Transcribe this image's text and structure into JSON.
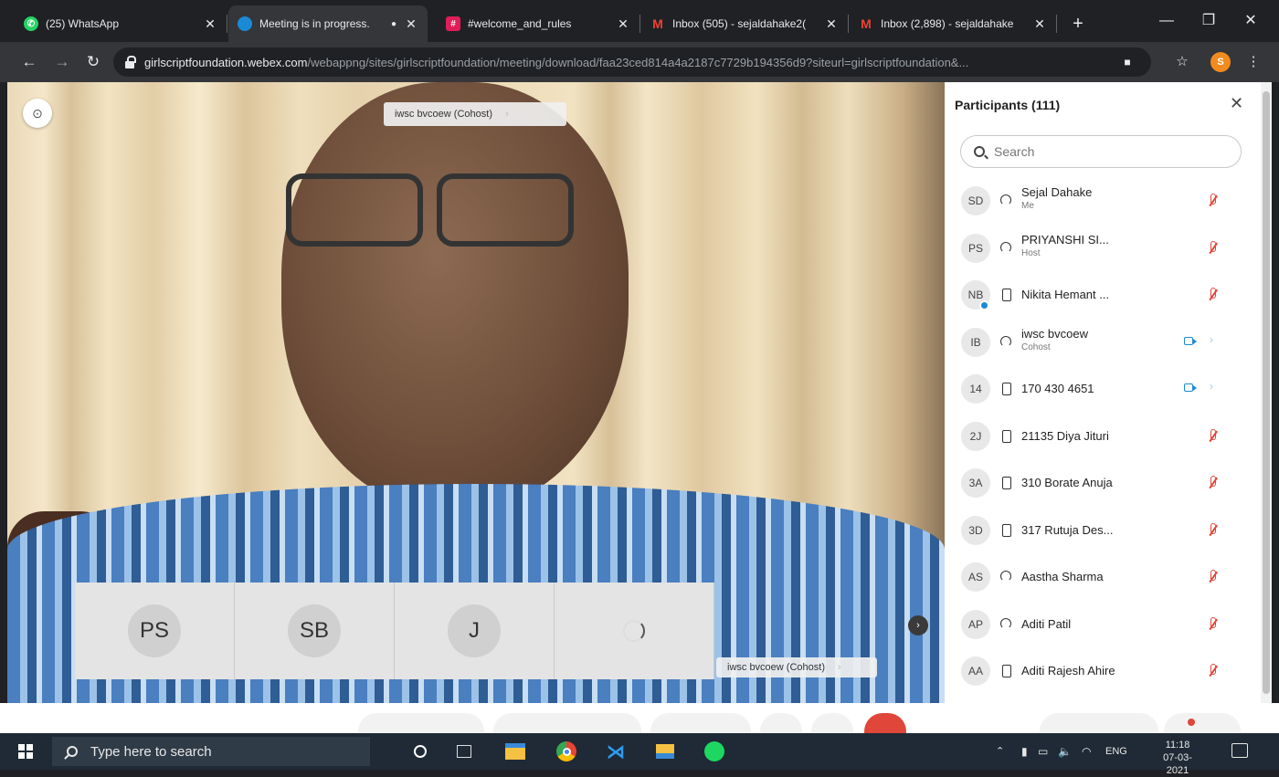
{
  "browser": {
    "tabs": [
      {
        "title": "(25) WhatsApp",
        "icon": "whatsapp-icon",
        "color": "#25d366",
        "glyph": "✆"
      },
      {
        "title": "Meeting is in progress.",
        "icon": "webex-icon",
        "color": "#1b8ad6",
        "glyph": ""
      },
      {
        "title": "#welcome_and_rules",
        "icon": "slack-icon",
        "color": "#e01e5a",
        "glyph": "#"
      },
      {
        "title": "Inbox (505) - sejaldahake2(",
        "icon": "gmail-icon",
        "color": "#ea4335",
        "glyph": "M"
      },
      {
        "title": "Inbox (2,898) - sejaldahake",
        "icon": "gmail-icon",
        "color": "#ea4335",
        "glyph": "M"
      }
    ],
    "new_tab_glyph": "+",
    "url_domain": "girlscriptfoundation.webex.com",
    "url_path": "/webappng/sites/girlscriptfoundation/meeting/download/faa23ced814a4a2187c7729b194356d9?siteurl=girlscriptfoundation&...",
    "profile_initial": "S"
  },
  "meeting": {
    "active_speaker_tag": "iwsc bvcoew (Cohost)",
    "self_video_tag": "iwsc bvcoew (Cohost)",
    "thumbnails": [
      {
        "initials": "PS"
      },
      {
        "initials": "SB"
      },
      {
        "initials": "J"
      },
      {
        "initials": ""
      }
    ]
  },
  "participants": {
    "title": "Participants (111)",
    "search_placeholder": "Search",
    "items": [
      {
        "initials": "SD",
        "name": "Sejal Dahake",
        "role": "Me",
        "device": "web",
        "muted": true,
        "video": false,
        "dot": false
      },
      {
        "initials": "PS",
        "name": "PRIYANSHI SI...",
        "role": "Host",
        "device": "web",
        "muted": true,
        "video": false,
        "dot": false
      },
      {
        "initials": "NB",
        "name": "Nikita Hemant ...",
        "role": "",
        "device": "mobile",
        "muted": true,
        "video": false,
        "dot": true
      },
      {
        "initials": "IB",
        "name": "iwsc bvcoew",
        "role": "Cohost",
        "device": "web",
        "muted": false,
        "video": true,
        "dot": false
      },
      {
        "initials": "14",
        "name": "170 430 4651",
        "role": "",
        "device": "mobile",
        "muted": false,
        "video": true,
        "dot": false
      },
      {
        "initials": "2J",
        "name": "21135 Diya Jituri",
        "role": "",
        "device": "mobile",
        "muted": true,
        "video": false,
        "dot": false
      },
      {
        "initials": "3A",
        "name": "310 Borate Anuja",
        "role": "",
        "device": "mobile",
        "muted": true,
        "video": false,
        "dot": false
      },
      {
        "initials": "3D",
        "name": "317 Rutuja Des...",
        "role": "",
        "device": "mobile",
        "muted": true,
        "video": false,
        "dot": false
      },
      {
        "initials": "AS",
        "name": "Aastha Sharma",
        "role": "",
        "device": "web",
        "muted": true,
        "video": false,
        "dot": false
      },
      {
        "initials": "AP",
        "name": "Aditi Patil",
        "role": "",
        "device": "web",
        "muted": true,
        "video": false,
        "dot": false
      },
      {
        "initials": "AA",
        "name": "Aditi Rajesh Ahire",
        "role": "",
        "device": "mobile",
        "muted": true,
        "video": false,
        "dot": false
      }
    ]
  },
  "taskbar": {
    "search_placeholder": "Type here to search",
    "language": "ENG",
    "time": "11:18",
    "date": "07-03-2021"
  },
  "colors": {
    "muted_red": "#e0463a",
    "webex_blue": "#1b8ad6"
  }
}
